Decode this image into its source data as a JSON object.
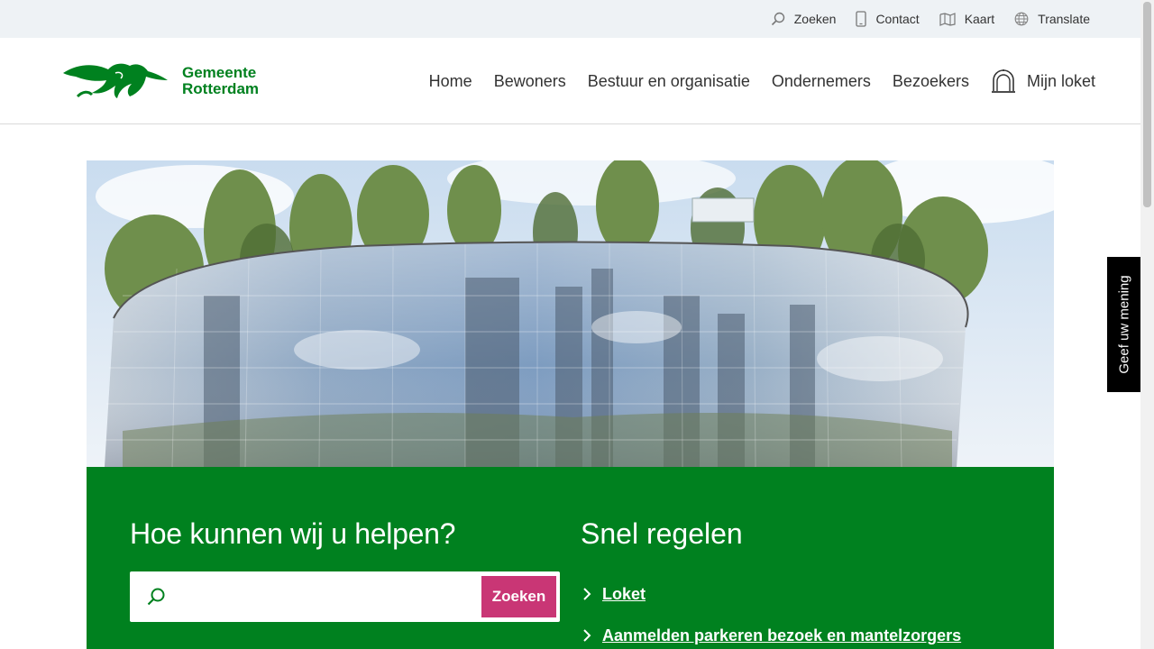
{
  "utility": {
    "items": [
      {
        "label": "Zoeken",
        "icon": "search-icon"
      },
      {
        "label": "Contact",
        "icon": "phone-icon"
      },
      {
        "label": "Kaart",
        "icon": "map-icon"
      },
      {
        "label": "Translate",
        "icon": "globe-icon"
      }
    ]
  },
  "logo": {
    "line1": "Gemeente",
    "line2": "Rotterdam"
  },
  "nav": {
    "items": [
      "Home",
      "Bewoners",
      "Bestuur en organisatie",
      "Ondernemers",
      "Bezoekers"
    ],
    "loket": "Mijn loket"
  },
  "help": {
    "title": "Hoe kunnen wij u helpen?",
    "search_value": "",
    "search_button": "Zoeken"
  },
  "quick": {
    "title": "Snel regelen",
    "links": [
      "Loket",
      "Aanmelden parkeren bezoek en mantelzorgers"
    ]
  },
  "feedback": {
    "label": "Geef uw mening"
  },
  "colors": {
    "brand_green": "#00811f",
    "accent_pink": "#c93675",
    "utility_bg": "#eef2f5"
  }
}
